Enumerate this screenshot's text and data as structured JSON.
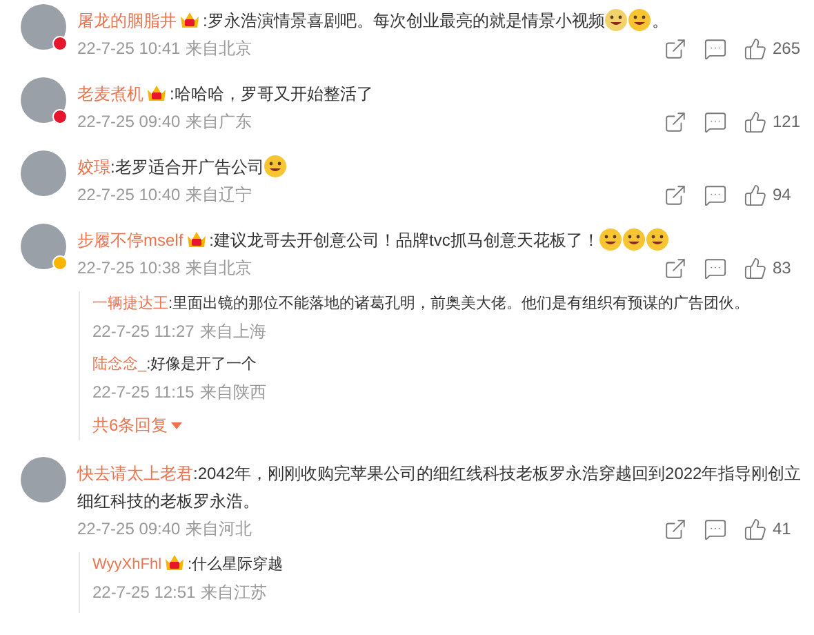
{
  "comments": [
    {
      "name": "屠龙的胭脂井",
      "badge": true,
      "verified": {
        "color": "#e6162d"
      },
      "parts": [
        {
          "kind": "text",
          "text": ":罗永浩演情景喜剧吧。每次创业最亮的就是情景小视频"
        },
        {
          "kind": "emoji",
          "color": "#f2d36b"
        },
        {
          "kind": "emoji",
          "color": "#f7c531"
        },
        {
          "kind": "text",
          "text": "。"
        }
      ],
      "time": "22-7-25 10:41",
      "location": "来自北京",
      "likes": "265"
    },
    {
      "name": "老麦煮机",
      "badge": true,
      "verified": {
        "color": "#e6162d"
      },
      "parts": [
        {
          "kind": "text",
          "text": ":哈哈哈，罗哥又开始整活了"
        }
      ],
      "time": "22-7-25 09:40",
      "location": "来自广东",
      "likes": "121"
    },
    {
      "name": "姣璟",
      "badge": false,
      "parts": [
        {
          "kind": "text",
          "text": ":老罗适合开广告公司"
        },
        {
          "kind": "emoji",
          "color": "#f7c531"
        }
      ],
      "time": "22-7-25 10:40",
      "location": "来自辽宁",
      "likes": "94"
    },
    {
      "name": "步履不停mself",
      "badge": true,
      "verified": {
        "color": "#f7b500"
      },
      "parts": [
        {
          "kind": "text",
          "text": ":建议龙哥去开创意公司！品牌tvc抓马创意天花板了！"
        },
        {
          "kind": "emoji",
          "color": "#f7c531"
        },
        {
          "kind": "emoji",
          "color": "#f7c531"
        },
        {
          "kind": "emoji",
          "color": "#f7c531"
        }
      ],
      "time": "22-7-25 10:38",
      "location": "来自北京",
      "likes": "83",
      "replies": [
        {
          "name": "一辆捷达王",
          "badge": false,
          "text": ":里面出镜的那位不能落地的诸葛孔明，前奥美大佬。他们是有组织有预谋的广告团伙。",
          "time": "22-7-25 11:27",
          "location": "来自上海"
        },
        {
          "name": "陆念念_",
          "badge": false,
          "text": ":好像是开了一个",
          "time": "22-7-25 11:15",
          "location": "来自陕西"
        }
      ],
      "more_replies": "共6条回复"
    },
    {
      "name": "快去请太上老君",
      "badge": false,
      "parts": [
        {
          "kind": "text",
          "text": ":2042年，刚刚收购完苹果公司的细红线科技老板罗永浩穿越回到2022年指导刚创立细红科技的老板罗永浩。"
        }
      ],
      "time": "22-7-25 09:40",
      "location": "来自河北",
      "likes": "41",
      "replies": [
        {
          "name": "WyyXhFhl",
          "badge": true,
          "text": ":什么星际穿越",
          "time": "22-7-25 12:51",
          "location": "来自江苏"
        }
      ]
    }
  ]
}
